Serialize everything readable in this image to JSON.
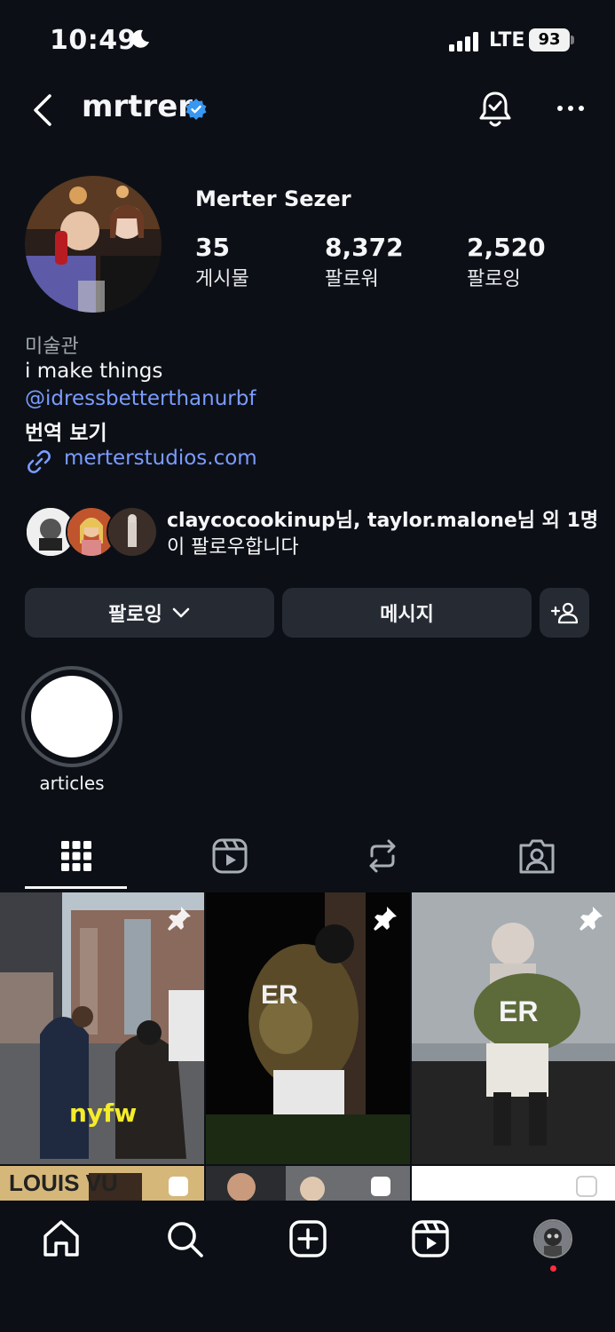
{
  "status_bar": {
    "time": "10:49",
    "network": "LTE",
    "battery": "93"
  },
  "header": {
    "username": "mrtrer"
  },
  "profile": {
    "full_name": "Merter Sezer",
    "stats": [
      {
        "value": "35",
        "label": "게시물"
      },
      {
        "value": "8,372",
        "label": "팔로워"
      },
      {
        "value": "2,520",
        "label": "팔로잉"
      }
    ],
    "category": "미술관",
    "bio": "i make things",
    "mention": "@idressbetterthanurbf",
    "translate": "번역 보기",
    "link": "merterstudios.com"
  },
  "followed_by": {
    "line1": "claycocookinup님, taylor.malone님 외 1명",
    "line2": "이 팔로우합니다"
  },
  "buttons": {
    "following": "팔로잉",
    "message": "메시지"
  },
  "highlights": [
    {
      "label": "articles"
    }
  ],
  "tabs": [
    "grid-icon",
    "reels-icon",
    "reposts-icon",
    "tagged-icon"
  ],
  "posts": [
    {
      "caption": "nyfw",
      "pinned": true
    },
    {
      "pinned": true
    },
    {
      "pinned": true
    }
  ],
  "nav": [
    "home-icon",
    "search-icon",
    "create-icon",
    "reels-icon",
    "profile-avatar"
  ],
  "colors": {
    "background": "#0c1016",
    "link": "#7b9bff",
    "button": "#262b33",
    "verified": "#3897f0",
    "notification": "#ff2d3f"
  }
}
